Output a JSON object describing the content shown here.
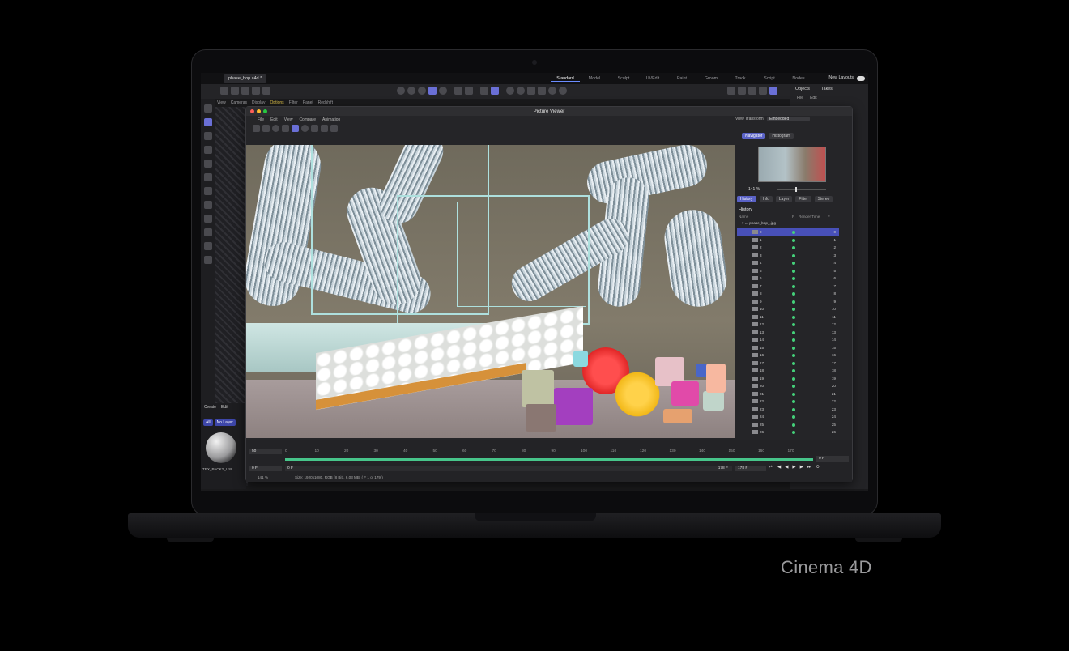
{
  "caption": "Cinema 4D",
  "app": {
    "doc_tab": "phase_bop.c4d *",
    "layouts": [
      "Standard",
      "Model",
      "Sculpt",
      "UVEdit",
      "Paint",
      "Groom",
      "Track",
      "Script",
      "Nodes"
    ],
    "active_layout": "Standard",
    "new_layouts": "New Layouts",
    "view_menu": [
      "View",
      "Cameras",
      "Display",
      "Options",
      "Filter",
      "Panel",
      "Redshift"
    ],
    "right_tabs": [
      "Objects",
      "Takes"
    ],
    "right_menu": [
      "File",
      "Edit"
    ],
    "material_menu": [
      "Create",
      "Edit"
    ],
    "material_buttons": [
      "All",
      "No Layer"
    ],
    "material_name": "TEX_PACK2_USI"
  },
  "picture_viewer": {
    "title": "Picture Viewer",
    "menu": [
      "File",
      "Edit",
      "View",
      "Compare",
      "Animation"
    ],
    "view_transform_label": "View Transform",
    "view_transform_value": "Embedded",
    "side_tabs_top": [
      "Navigator",
      "Histogram"
    ],
    "zoom": "141 %",
    "side_tabs": [
      "History",
      "Info",
      "Layer",
      "Filter",
      "Stereo"
    ],
    "history_title": "History",
    "columns": [
      "Name",
      "R",
      "Render Time",
      "F"
    ],
    "folder": "phase_bop_.jpg",
    "frames": [
      "0",
      "1",
      "2",
      "3",
      "4",
      "5",
      "6",
      "7",
      "8",
      "9",
      "10",
      "11",
      "12",
      "13",
      "14",
      "15",
      "16",
      "17",
      "18",
      "19",
      "20",
      "21",
      "22",
      "23",
      "24",
      "25",
      "26"
    ],
    "ruler": [
      "0",
      "10",
      "20",
      "30",
      "40",
      "50",
      "60",
      "70",
      "80",
      "90",
      "100",
      "110",
      "120",
      "130",
      "140",
      "150",
      "160",
      "170"
    ],
    "start_field": "50",
    "frame_field": "0 F",
    "frame_field2": "0 F",
    "end_field": "178 F",
    "end_field2": "178 F",
    "right_field": "0 F",
    "status_zoom": "141 %",
    "status_info": "Size: 1920x1080, RGB (8 Bit), 6.03 MB,  ( F 1 of 179 )"
  },
  "colors": {
    "accent": "#5a62c6",
    "render_ok": "#44d17a",
    "timeline": "#47c58a"
  }
}
